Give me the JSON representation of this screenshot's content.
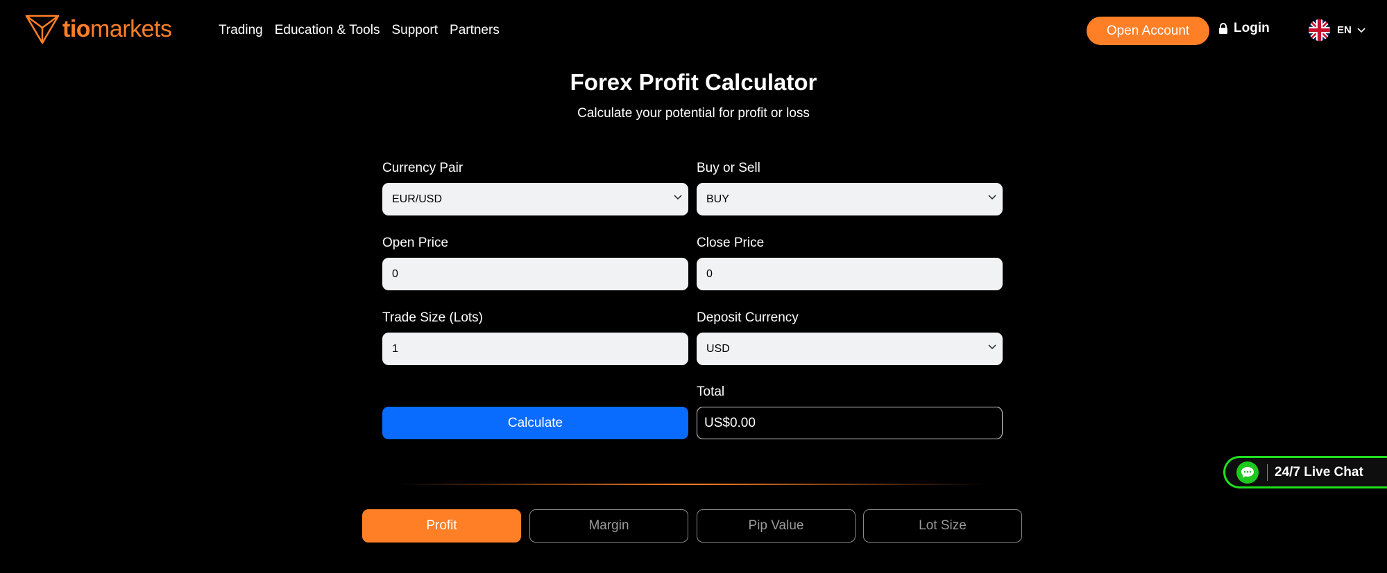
{
  "header": {
    "logo_bold": "tio",
    "logo_light": "markets",
    "nav": [
      "Trading",
      "Education & Tools",
      "Support",
      "Partners"
    ],
    "open_account": "Open Account",
    "login": "Login",
    "language": "EN"
  },
  "page": {
    "title": "Forex Profit Calculator",
    "subtitle": "Calculate your potential for profit or loss"
  },
  "form": {
    "currency_pair": {
      "label": "Currency Pair",
      "value": "EUR/USD"
    },
    "buy_sell": {
      "label": "Buy or Sell",
      "value": "BUY"
    },
    "open_price": {
      "label": "Open Price",
      "value": "0"
    },
    "close_price": {
      "label": "Close Price",
      "value": "0"
    },
    "trade_size": {
      "label": "Trade Size (Lots)",
      "value": "1"
    },
    "deposit_currency": {
      "label": "Deposit Currency",
      "value": "USD"
    },
    "calculate": "Calculate",
    "total": {
      "label": "Total",
      "value": "US$0.00"
    }
  },
  "tabs": [
    {
      "label": "Profit",
      "active": true
    },
    {
      "label": "Margin",
      "active": false
    },
    {
      "label": "Pip Value",
      "active": false
    },
    {
      "label": "Lot Size",
      "active": false
    }
  ],
  "live_chat": "24/7 Live Chat",
  "colors": {
    "accent": "#ff7f27",
    "primary_button": "#0a6cff",
    "chat_green": "#1ee01e",
    "background": "#000000"
  },
  "icons": [
    "tiomarkets-logo-icon",
    "lock-icon",
    "uk-flag-icon",
    "chevron-down-icon",
    "chat-bubble-icon"
  ]
}
